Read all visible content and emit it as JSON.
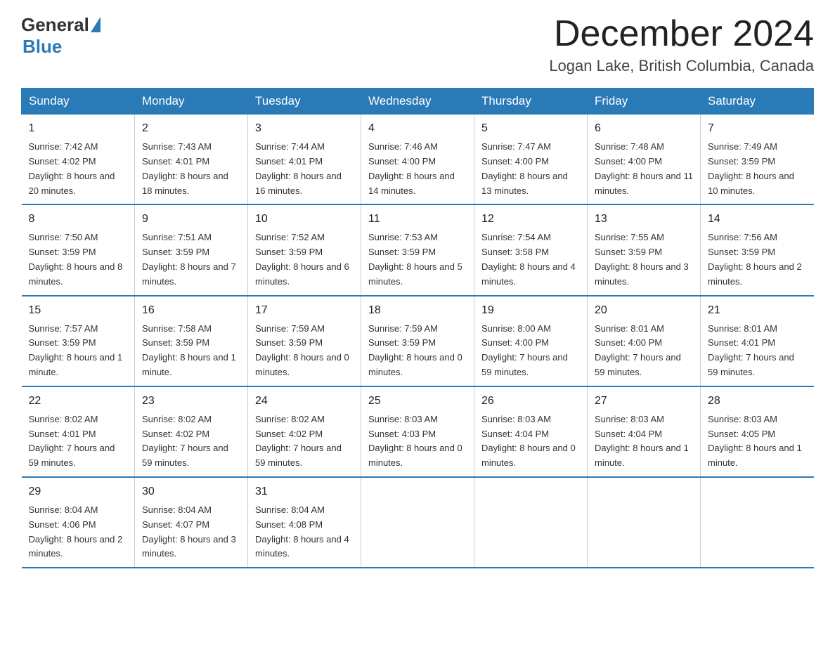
{
  "header": {
    "logo_general": "General",
    "logo_blue": "Blue",
    "month": "December 2024",
    "location": "Logan Lake, British Columbia, Canada"
  },
  "days_of_week": [
    "Sunday",
    "Monday",
    "Tuesday",
    "Wednesday",
    "Thursday",
    "Friday",
    "Saturday"
  ],
  "weeks": [
    [
      {
        "day": "1",
        "sunrise": "7:42 AM",
        "sunset": "4:02 PM",
        "daylight": "8 hours and 20 minutes."
      },
      {
        "day": "2",
        "sunrise": "7:43 AM",
        "sunset": "4:01 PM",
        "daylight": "8 hours and 18 minutes."
      },
      {
        "day": "3",
        "sunrise": "7:44 AM",
        "sunset": "4:01 PM",
        "daylight": "8 hours and 16 minutes."
      },
      {
        "day": "4",
        "sunrise": "7:46 AM",
        "sunset": "4:00 PM",
        "daylight": "8 hours and 14 minutes."
      },
      {
        "day": "5",
        "sunrise": "7:47 AM",
        "sunset": "4:00 PM",
        "daylight": "8 hours and 13 minutes."
      },
      {
        "day": "6",
        "sunrise": "7:48 AM",
        "sunset": "4:00 PM",
        "daylight": "8 hours and 11 minutes."
      },
      {
        "day": "7",
        "sunrise": "7:49 AM",
        "sunset": "3:59 PM",
        "daylight": "8 hours and 10 minutes."
      }
    ],
    [
      {
        "day": "8",
        "sunrise": "7:50 AM",
        "sunset": "3:59 PM",
        "daylight": "8 hours and 8 minutes."
      },
      {
        "day": "9",
        "sunrise": "7:51 AM",
        "sunset": "3:59 PM",
        "daylight": "8 hours and 7 minutes."
      },
      {
        "day": "10",
        "sunrise": "7:52 AM",
        "sunset": "3:59 PM",
        "daylight": "8 hours and 6 minutes."
      },
      {
        "day": "11",
        "sunrise": "7:53 AM",
        "sunset": "3:59 PM",
        "daylight": "8 hours and 5 minutes."
      },
      {
        "day": "12",
        "sunrise": "7:54 AM",
        "sunset": "3:58 PM",
        "daylight": "8 hours and 4 minutes."
      },
      {
        "day": "13",
        "sunrise": "7:55 AM",
        "sunset": "3:59 PM",
        "daylight": "8 hours and 3 minutes."
      },
      {
        "day": "14",
        "sunrise": "7:56 AM",
        "sunset": "3:59 PM",
        "daylight": "8 hours and 2 minutes."
      }
    ],
    [
      {
        "day": "15",
        "sunrise": "7:57 AM",
        "sunset": "3:59 PM",
        "daylight": "8 hours and 1 minute."
      },
      {
        "day": "16",
        "sunrise": "7:58 AM",
        "sunset": "3:59 PM",
        "daylight": "8 hours and 1 minute."
      },
      {
        "day": "17",
        "sunrise": "7:59 AM",
        "sunset": "3:59 PM",
        "daylight": "8 hours and 0 minutes."
      },
      {
        "day": "18",
        "sunrise": "7:59 AM",
        "sunset": "3:59 PM",
        "daylight": "8 hours and 0 minutes."
      },
      {
        "day": "19",
        "sunrise": "8:00 AM",
        "sunset": "4:00 PM",
        "daylight": "7 hours and 59 minutes."
      },
      {
        "day": "20",
        "sunrise": "8:01 AM",
        "sunset": "4:00 PM",
        "daylight": "7 hours and 59 minutes."
      },
      {
        "day": "21",
        "sunrise": "8:01 AM",
        "sunset": "4:01 PM",
        "daylight": "7 hours and 59 minutes."
      }
    ],
    [
      {
        "day": "22",
        "sunrise": "8:02 AM",
        "sunset": "4:01 PM",
        "daylight": "7 hours and 59 minutes."
      },
      {
        "day": "23",
        "sunrise": "8:02 AM",
        "sunset": "4:02 PM",
        "daylight": "7 hours and 59 minutes."
      },
      {
        "day": "24",
        "sunrise": "8:02 AM",
        "sunset": "4:02 PM",
        "daylight": "7 hours and 59 minutes."
      },
      {
        "day": "25",
        "sunrise": "8:03 AM",
        "sunset": "4:03 PM",
        "daylight": "8 hours and 0 minutes."
      },
      {
        "day": "26",
        "sunrise": "8:03 AM",
        "sunset": "4:04 PM",
        "daylight": "8 hours and 0 minutes."
      },
      {
        "day": "27",
        "sunrise": "8:03 AM",
        "sunset": "4:04 PM",
        "daylight": "8 hours and 1 minute."
      },
      {
        "day": "28",
        "sunrise": "8:03 AM",
        "sunset": "4:05 PM",
        "daylight": "8 hours and 1 minute."
      }
    ],
    [
      {
        "day": "29",
        "sunrise": "8:04 AM",
        "sunset": "4:06 PM",
        "daylight": "8 hours and 2 minutes."
      },
      {
        "day": "30",
        "sunrise": "8:04 AM",
        "sunset": "4:07 PM",
        "daylight": "8 hours and 3 minutes."
      },
      {
        "day": "31",
        "sunrise": "8:04 AM",
        "sunset": "4:08 PM",
        "daylight": "8 hours and 4 minutes."
      },
      null,
      null,
      null,
      null
    ]
  ],
  "labels": {
    "sunrise": "Sunrise: ",
    "sunset": "Sunset: ",
    "daylight": "Daylight: "
  }
}
